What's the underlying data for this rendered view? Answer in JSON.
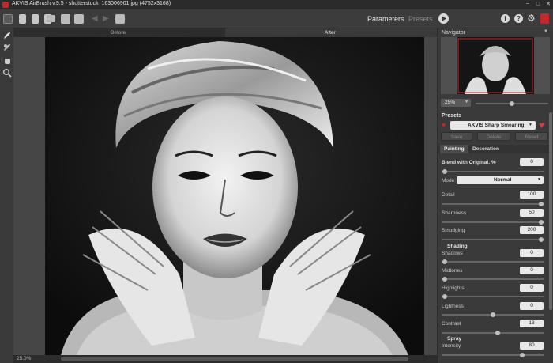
{
  "window": {
    "title": "AKVIS AirBrush v.9.5 - shutterstock_163006901.jpg (4752x3168)"
  },
  "toolbar": {
    "parameters_label": "Parameters",
    "presets_label": "Presets"
  },
  "view_tabs": {
    "before": "Before",
    "after": "After"
  },
  "status": {
    "zoom": "25.0%"
  },
  "navigator": {
    "title": "Navigator",
    "zoom": "25%",
    "zoom_fraction": 0.5
  },
  "presets": {
    "title": "Presets",
    "selected": "AKVIS Sharp Smearing",
    "save_label": "Save",
    "delete_label": "Delete",
    "reset_label": "Reset"
  },
  "tabs": {
    "painting": "Painting",
    "decoration": "Decoration"
  },
  "params": {
    "blend": {
      "label": "Blend with Original, %",
      "value": "0",
      "fraction": 0.0
    },
    "mode": {
      "label": "Mode:",
      "value": "Normal"
    },
    "detail": {
      "label": "Detail",
      "value": "100",
      "fraction": 1.0
    },
    "sharpness": {
      "label": "Sharpness",
      "value": "50",
      "fraction": 1.0
    },
    "smudging": {
      "label": "Smudging",
      "value": "200",
      "fraction": 1.0
    },
    "shading_title": "Shading",
    "shadows": {
      "label": "Shadows",
      "value": "0",
      "fraction": 0.0
    },
    "midtones": {
      "label": "Midtones",
      "value": "0",
      "fraction": 0.0
    },
    "highlights": {
      "label": "Highlights",
      "value": "0",
      "fraction": 0.0
    },
    "lightness": {
      "label": "Lightness",
      "value": "0",
      "fraction": 0.5
    },
    "contrast": {
      "label": "Contrast",
      "value": "13",
      "fraction": 0.55
    },
    "spray_title": "Spray",
    "intensity": {
      "label": "Intensity",
      "value": "80",
      "fraction": 0.8
    }
  },
  "colors": {
    "accent_red": "#c0282b",
    "panel_bg": "#3a3a3a"
  }
}
